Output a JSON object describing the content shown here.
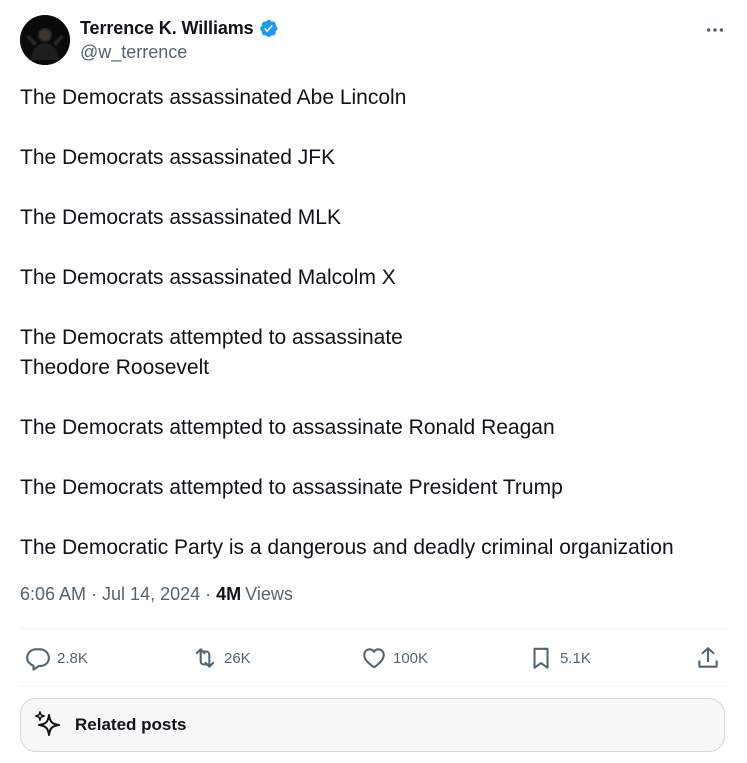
{
  "author": {
    "display_name": "Terrence K. Williams",
    "handle": "@w_terrence",
    "verified": true,
    "verified_color": "#1d9bf0"
  },
  "more_icon": "more-horizontal-icon",
  "tweet": {
    "paragraphs": [
      "The Democrats assassinated Abe Lincoln",
      "The Democrats assassinated JFK",
      "The Democrats assassinated MLK",
      "The Democrats assassinated Malcolm X",
      "The Democrats attempted to assassinate\nTheodore Roosevelt",
      "The Democrats attempted to assassinate Ronald Reagan",
      "The Democrats attempted to assassinate President Trump",
      "The Democratic Party is a dangerous and deadly criminal organization"
    ]
  },
  "meta": {
    "time": "6:06 AM",
    "date": "Jul 14, 2024",
    "views_count": "4M",
    "views_label": "Views",
    "separator": "·"
  },
  "actions": {
    "replies": {
      "icon": "reply-icon",
      "count": "2.8K"
    },
    "reposts": {
      "icon": "repost-icon",
      "count": "26K"
    },
    "likes": {
      "icon": "like-icon",
      "count": "100K"
    },
    "bookmarks": {
      "icon": "bookmark-icon",
      "count": "5.1K"
    },
    "share": {
      "icon": "share-icon"
    }
  },
  "related": {
    "label": "Related posts",
    "icon": "sparkle-icon"
  },
  "colors": {
    "text_primary": "#0f1419",
    "text_secondary": "#536471",
    "divider": "#eff3f4",
    "border": "#cfd9de"
  }
}
